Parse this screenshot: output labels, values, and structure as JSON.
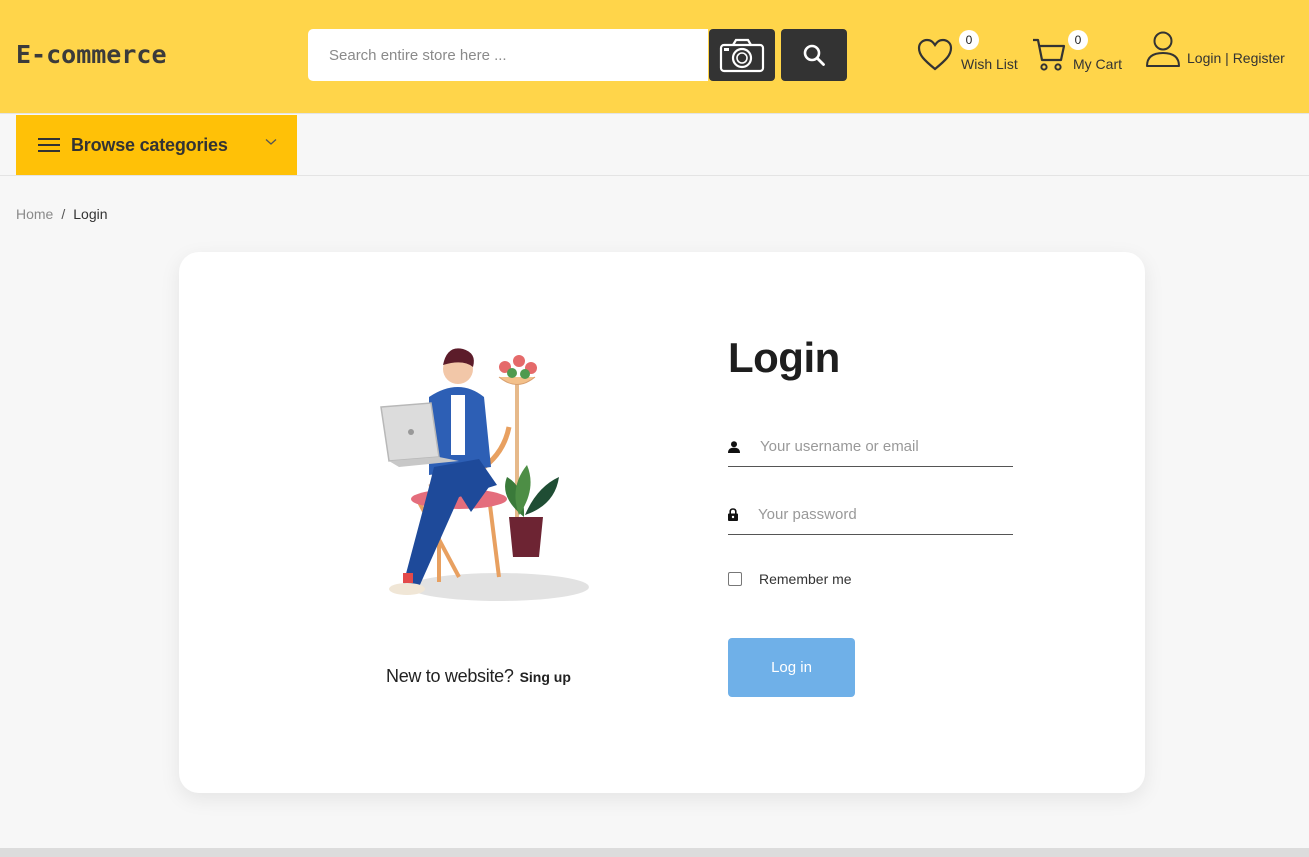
{
  "header": {
    "logo": "E-commerce",
    "search_placeholder": "Search entire store here ...",
    "camera_icon": "camera-icon",
    "search_icon": "search-icon",
    "wishlist": {
      "count": "0",
      "label": "Wish List"
    },
    "cart": {
      "count": "0",
      "label": "My Cart"
    },
    "account": {
      "login": "Login",
      "separator": " | ",
      "register": "Register"
    }
  },
  "nav": {
    "browse_label": "Browse categories"
  },
  "breadcrumb": {
    "home": "Home",
    "separator": "/",
    "current": "Login"
  },
  "login": {
    "title": "Login",
    "username_placeholder": "Your username or email",
    "password_placeholder": "Your password",
    "remember_label": "Remember me",
    "submit_label": "Log in",
    "new_prompt": "New to website?",
    "signup_label": "Sing up"
  },
  "colors": {
    "header_bg": "#ffd54a",
    "browse_bg": "#ffc107",
    "login_button": "#6fb0e8",
    "dark_button": "#333333"
  }
}
